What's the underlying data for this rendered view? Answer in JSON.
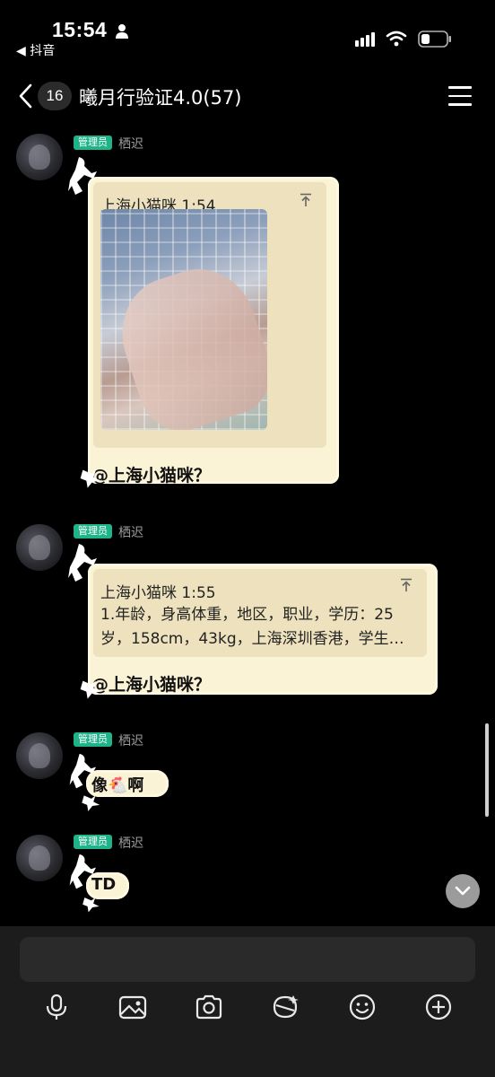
{
  "status_bar": {
    "time": "15:54",
    "back_to_app": "◀ 抖音"
  },
  "header": {
    "unread_count": "16",
    "title": "曦月行验证4.0(57)"
  },
  "messages": [
    {
      "role": "管理员",
      "sender": "栖迟",
      "quote": {
        "name": "上海小猫咪 1:54",
        "type": "image"
      },
      "text": "@上海小猫咪？"
    },
    {
      "role": "管理员",
      "sender": "栖迟",
      "quote": {
        "name": "上海小猫咪 1:55",
        "line1": "1.年龄，身高体重，地区，职业，学历：25",
        "line2": "岁，158cm，43kg，上海深圳香港，学生…"
      },
      "text": "@上海小猫咪？"
    },
    {
      "role": "管理员",
      "sender": "栖迟",
      "text": "像🐔啊"
    },
    {
      "role": "管理员",
      "sender": "栖迟",
      "text": "TD"
    }
  ],
  "toolbar": [
    "microphone-icon",
    "image-icon",
    "camera-icon",
    "sticker-icon",
    "emoji-icon",
    "plus-icon"
  ]
}
